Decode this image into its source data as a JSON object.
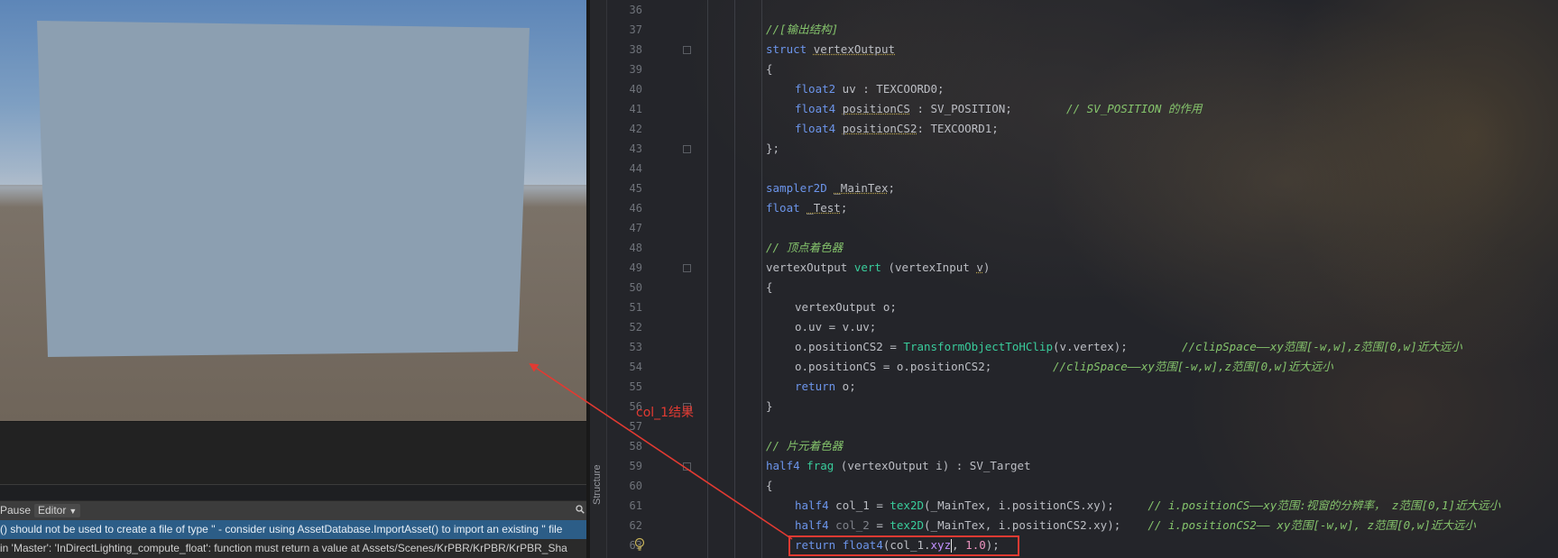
{
  "scene_view": {
    "sky_color": "#7e9fc2",
    "ground_color": "#746a5f",
    "quad_color": "#8c9fb1"
  },
  "console": {
    "toolbar": {
      "pause_label": "Pause",
      "editor_label": "Editor"
    },
    "messages": [
      "() should not be used to create a file of type '' - consider using AssetDatabase.ImportAsset() to import an existing '' file",
      " in 'Master': 'InDirectLighting_compute_float': function must return a value at Assets/Scenes/KrPBR/KrPBR/KrPBR_Sha"
    ]
  },
  "editor": {
    "structure_label": "Structure",
    "line_numbers": [
      "36",
      "37",
      "38",
      "39",
      "40",
      "41",
      "42",
      "43",
      "44",
      "45",
      "46",
      "47",
      "48",
      "49",
      "50",
      "51",
      "52",
      "53",
      "54",
      "55",
      "56",
      "57",
      "58",
      "59",
      "60",
      "61",
      "62",
      "63"
    ],
    "lines": {
      "l37_comment": "//[输出结构]",
      "l38_kw": "struct",
      "l38_name": "vertexOutput",
      "l39": "{",
      "l40_type": "float2",
      "l40_rest": " uv : TEXCOORD0;",
      "l41_type": "float4",
      "l41_var": "positionCS",
      "l41_rest": " : SV_POSITION;        ",
      "l41_comment": "// SV_POSITION 的作用",
      "l42_type": "float4",
      "l42_var": "positionCS2",
      "l42_rest": ": TEXCOORD1;",
      "l43": "};",
      "l45_type": "sampler2D",
      "l45_var": "_MainTex",
      "l45_rest": ";",
      "l46_type": "float",
      "l46_var": "_Test",
      "l46_rest": ";",
      "l48_comment": "// 顶点着色器",
      "l49_type": "vertexOutput",
      "l49_fn": "vert",
      "l49_params": " (vertexInput ",
      "l49_v": "v",
      "l49_end": ")",
      "l50": "{",
      "l51": "vertexOutput o;",
      "l52": "o.uv = v.uv;",
      "l53_pre": "o.positionCS2 = ",
      "l53_fn": "TransformObjectToHClip",
      "l53_rest": "(v.vertex);        ",
      "l53_comment": "//clipSpace——xy范围[-w,w],z范围[0,w]近大远小",
      "l54_pre": "o.positionCS = o.positionCS2;         ",
      "l54_comment": "//clipSpace——xy范围[-w,w],z范围[0,w]近大远小",
      "l55_kw": "return",
      "l55_rest": " o;",
      "l56": "}",
      "l58_comment": "// 片元着色器",
      "l59_type": "half4",
      "l59_fn": "frag",
      "l59_rest": " (vertexOutput i) : SV_Target",
      "l60": "{",
      "l61_type": "half4",
      "l61_var": " col_1 = ",
      "l61_fn": "tex2D",
      "l61_rest": "(_MainTex, i.positionCS.xy);     ",
      "l61_comment": "// i.positionCS——xy范围:视窗的分辨率， z范围[0,1]近大远小",
      "l62_type": "half4",
      "l62_var": " col_2",
      "l62_eq": " = ",
      "l62_fn": "tex2D",
      "l62_rest": "(_MainTex, i.positionCS2.xy);    ",
      "l62_comment": "// i.positionCS2—— xy范围[-w,w], z范围[0,w]近大远小",
      "l63_kw": "return",
      "l63_sp": " ",
      "l63_type": "float4",
      "l63_open": "(col_1.",
      "l63_swz": "xyz",
      "l63_mid": ", ",
      "l63_num": "1.0",
      "l63_end": ");"
    }
  },
  "annotation": {
    "label": "col_1结果",
    "color": "#e23a32"
  }
}
